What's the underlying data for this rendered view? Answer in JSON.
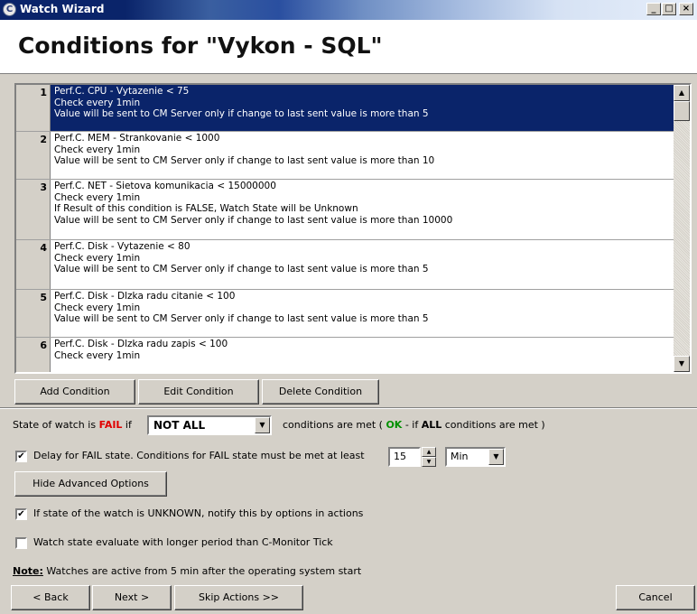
{
  "window": {
    "title": "Watch Wizard",
    "controls": {
      "minimize": "_",
      "maximize": "□",
      "close": "×"
    }
  },
  "header": {
    "heading": "Conditions for \"Vykon - SQL\""
  },
  "conditions": [
    {
      "num": "1",
      "lines": [
        "Perf.C. CPU - Vytazenie < 75",
        "Check every 1min",
        "Value will be sent to CM Server only if change to last sent value is more than 5"
      ]
    },
    {
      "num": "2",
      "lines": [
        "Perf.C. MEM - Strankovanie < 1000",
        "Check every 1min",
        "Value will be sent to CM Server only if change to last sent value is more than 10"
      ]
    },
    {
      "num": "3",
      "lines": [
        "Perf.C. NET - Sietova komunikacia < 15000000",
        "Check every 1min",
        "If Result of this condition is FALSE, Watch State will be Unknown",
        "Value will be sent to CM Server only if change to last sent value is more than 10000"
      ]
    },
    {
      "num": "4",
      "lines": [
        "Perf.C. Disk - Vytazenie < 80",
        "Check every 1min",
        "Value will be sent to CM Server only if change to last sent value is more than 5"
      ]
    },
    {
      "num": "5",
      "lines": [
        "Perf.C. Disk - Dlzka radu citanie < 100",
        "Check every 1min",
        "Value will be sent to CM Server only if change to last sent value is more than 5"
      ]
    },
    {
      "num": "6",
      "lines": [
        "Perf.C. Disk - Dlzka radu zapis < 100",
        "Check every 1min"
      ]
    }
  ],
  "scrollbar": {
    "up": "▲",
    "down": "▼"
  },
  "buttons": {
    "add": "Add Condition",
    "edit": "Edit Condition",
    "delete": "Delete Condition",
    "hide_advanced": "Hide Advanced Options",
    "back": "< Back",
    "next": "Next >",
    "skip": "Skip Actions >>",
    "cancel": "Cancel"
  },
  "state_line": {
    "prefix": "State of watch is ",
    "fail": "FAIL",
    "if": " if",
    "combo_value": "NOT ALL",
    "suffix_1": "conditions are met ( ",
    "ok": "OK",
    "suffix_2": " - if ",
    "all": "ALL",
    "suffix_3": " conditions are met )"
  },
  "delay": {
    "checked": true,
    "label": "Delay for FAIL state. Conditions for FAIL state must be met at least",
    "value": "15",
    "unit": "Min"
  },
  "options": {
    "unknown_checked": true,
    "unknown_label": "If state of the watch is UNKNOWN, notify this by options in actions",
    "longer_checked": false,
    "longer_label": "Watch state evaluate with longer period than C-Monitor Tick"
  },
  "note": {
    "label": "Note:",
    "text": " Watches are active from 5 min after the operating system start"
  },
  "icons": {
    "check": "✔",
    "dropdown": "▼",
    "spin_up": "▲",
    "spin_down": "▼",
    "app": "C"
  }
}
